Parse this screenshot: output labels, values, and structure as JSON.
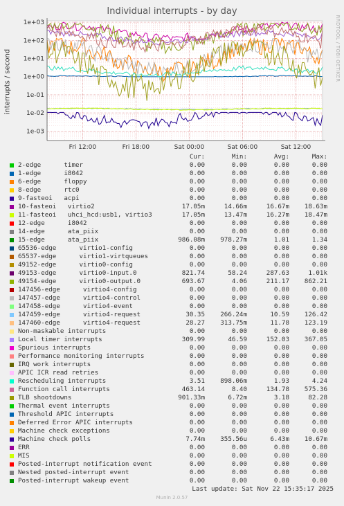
{
  "chart_data": {
    "type": "line",
    "title": "Individual interrupts - by day",
    "ylabel": "interrupts / second",
    "yscale": "log",
    "ylim": [
      0.0003,
      1200
    ],
    "y_ticks": [
      {
        "value": 1000,
        "label": "1e+03"
      },
      {
        "value": 100,
        "label": "1e+02"
      },
      {
        "value": 10,
        "label": "1e+01"
      },
      {
        "value": 1,
        "label": "1e+00"
      },
      {
        "value": 0.1,
        "label": "1e-01"
      },
      {
        "value": 0.01,
        "label": "1e-02"
      },
      {
        "value": 0.001,
        "label": "1e-03"
      }
    ],
    "x_ticks": [
      "Fri 12:00",
      "Fri 18:00",
      "Sat 00:00",
      "Sat 06:00",
      "Sat 12:00"
    ],
    "x_range_hours": [
      0,
      31
    ],
    "x_tick_positions_hours": [
      4,
      10,
      16,
      22,
      28
    ],
    "grid": true,
    "series": [
      {
        "name": "10-fasteoi virtio2",
        "color": "#7aa6c2",
        "cur": 0.01705,
        "min": 0.01466,
        "avg": 0.01667,
        "max": 0.01863
      },
      {
        "name": "11-fasteoi uhci_hcd:usb1, virtio3",
        "color": "#ccff00",
        "cur": 0.01705,
        "min": 0.01347,
        "avg": 0.01627,
        "max": 0.01847
      },
      {
        "name": "15-edge ata_piix",
        "color": "#0066b3",
        "cur": 0.98608,
        "min": 0.97827,
        "avg": 1.01,
        "max": 1.34
      },
      {
        "name": "49153-edge virtio0-input.0",
        "color": "#cc00a3",
        "cur": 821.74,
        "min": 58.24,
        "avg": 287.63,
        "max": 1010
      },
      {
        "name": "49154-edge virtio0-output.0",
        "color": "#8fa320",
        "cur": 693.67,
        "min": 4.06,
        "avg": 211.17,
        "max": 862.21
      },
      {
        "name": "147459-edge virtio4-request",
        "color": "#ff7f00",
        "cur": 30.35,
        "min": 0.266,
        "avg": 10.59,
        "max": 126.42
      },
      {
        "name": "147460-edge virtio4-request",
        "color": "#b8b8b8",
        "cur": 28.27,
        "min": 0.3138,
        "avg": 11.78,
        "max": 123.19
      },
      {
        "name": "Local timer interrupts",
        "color": "#a060d0",
        "cur": 309.99,
        "min": 46.59,
        "avg": 152.03,
        "max": 367.05
      },
      {
        "name": "Rescheduling interrupts",
        "color": "#33e0c0",
        "cur": 3.51,
        "min": 0.898,
        "avg": 1.93,
        "max": 4.24
      },
      {
        "name": "Function call interrupts",
        "color": "#c07070",
        "cur": 463.14,
        "min": 8.4,
        "avg": 134.78,
        "max": 575.36
      },
      {
        "name": "TLB shootdowns",
        "color": "#a0a020",
        "cur": 0.90133,
        "min": 0.00672,
        "avg": 3.18,
        "max": 82.28
      },
      {
        "name": "Machine check polls",
        "color": "#200090",
        "cur": 0.00774,
        "min": 0.000356,
        "avg": 0.00643,
        "max": 0.01067
      }
    ]
  },
  "watermark": "RRDTOOL / TOBI OETIKER",
  "legend": {
    "headers": [
      "Cur:",
      "Min:",
      "Avg:",
      "Max:"
    ],
    "rows": [
      {
        "label": "2-edge      timer",
        "color": "#00cc00",
        "cur": "0.00",
        "min": "0.00",
        "avg": "0.00",
        "max": "0.00"
      },
      {
        "label": "1-edge      i8042",
        "color": "#0066b3",
        "cur": "0.00",
        "min": "0.00",
        "avg": "0.00",
        "max": "0.00"
      },
      {
        "label": "6-edge      floppy",
        "color": "#ff8000",
        "cur": "0.00",
        "min": "0.00",
        "avg": "0.00",
        "max": "0.00"
      },
      {
        "label": "8-edge      rtc0",
        "color": "#ffcc00",
        "cur": "0.00",
        "min": "0.00",
        "avg": "0.00",
        "max": "0.00"
      },
      {
        "label": "9-fasteoi   acpi",
        "color": "#330099",
        "cur": "0.00",
        "min": "0.00",
        "avg": "0.00",
        "max": "0.00"
      },
      {
        "label": "10-fasteoi   virtio2",
        "color": "#990099",
        "cur": "17.05m",
        "min": "14.66m",
        "avg": "16.67m",
        "max": "18.63m"
      },
      {
        "label": "11-fasteoi   uhci_hcd:usb1, virtio3",
        "color": "#ccff00",
        "cur": "17.05m",
        "min": "13.47m",
        "avg": "16.27m",
        "max": "18.47m"
      },
      {
        "label": "12-edge      i8042",
        "color": "#ff0000",
        "cur": "0.00",
        "min": "0.00",
        "avg": "0.00",
        "max": "0.00"
      },
      {
        "label": "14-edge      ata_piix",
        "color": "#808080",
        "cur": "0.00",
        "min": "0.00",
        "avg": "0.00",
        "max": "0.00"
      },
      {
        "label": "15-edge      ata_piix",
        "color": "#008f00",
        "cur": "986.08m",
        "min": "978.27m",
        "avg": "1.01",
        "max": "1.34"
      },
      {
        "label": "65536-edge      virtio1-config",
        "color": "#00487d",
        "cur": "0.00",
        "min": "0.00",
        "avg": "0.00",
        "max": "0.00"
      },
      {
        "label": "65537-edge      virtio1-virtqueues",
        "color": "#b35a00",
        "cur": "0.00",
        "min": "0.00",
        "avg": "0.00",
        "max": "0.00"
      },
      {
        "label": "49152-edge      virtio0-config",
        "color": "#b38f00",
        "cur": "0.00",
        "min": "0.00",
        "avg": "0.00",
        "max": "0.00"
      },
      {
        "label": "49153-edge      virtio0-input.0",
        "color": "#6b006b",
        "cur": "821.74",
        "min": "58.24",
        "avg": "287.63",
        "max": "1.01k"
      },
      {
        "label": "49154-edge      virtio0-output.0",
        "color": "#8fb300",
        "cur": "693.67",
        "min": "4.06",
        "avg": "211.17",
        "max": "862.21"
      },
      {
        "label": "147456-edge      virtio4-config",
        "color": "#b30000",
        "cur": "0.00",
        "min": "0.00",
        "avg": "0.00",
        "max": "0.00"
      },
      {
        "label": "147457-edge      virtio4-control",
        "color": "#bebebe",
        "cur": "0.00",
        "min": "0.00",
        "avg": "0.00",
        "max": "0.00"
      },
      {
        "label": "147458-edge      virtio4-event",
        "color": "#80ff80",
        "cur": "0.00",
        "min": "0.00",
        "avg": "0.00",
        "max": "0.00"
      },
      {
        "label": "147459-edge      virtio4-request",
        "color": "#80c9ff",
        "cur": "30.35",
        "min": "266.24m",
        "avg": "10.59",
        "max": "126.42"
      },
      {
        "label": "147460-edge      virtio4-request",
        "color": "#ffc080",
        "cur": "28.27",
        "min": "313.75m",
        "avg": "11.78",
        "max": "123.19"
      },
      {
        "label": "Non-maskable interrupts",
        "color": "#ffe680",
        "cur": "0.00",
        "min": "0.00",
        "avg": "0.00",
        "max": "0.00"
      },
      {
        "label": "Local timer interrupts",
        "color": "#aa80ff",
        "cur": "309.99",
        "min": "46.59",
        "avg": "152.03",
        "max": "367.05"
      },
      {
        "label": "Spurious interrupts",
        "color": "#ee00cc",
        "cur": "0.00",
        "min": "0.00",
        "avg": "0.00",
        "max": "0.00"
      },
      {
        "label": "Performance monitoring interrupts",
        "color": "#ff8080",
        "cur": "0.00",
        "min": "0.00",
        "avg": "0.00",
        "max": "0.00"
      },
      {
        "label": "IRQ work interrupts",
        "color": "#666600",
        "cur": "0.00",
        "min": "0.00",
        "avg": "0.00",
        "max": "0.00"
      },
      {
        "label": "APIC ICR read retries",
        "color": "#ffbfff",
        "cur": "0.00",
        "min": "0.00",
        "avg": "0.00",
        "max": "0.00"
      },
      {
        "label": "Rescheduling interrupts",
        "color": "#00ffcc",
        "cur": "3.51",
        "min": "898.06m",
        "avg": "1.93",
        "max": "4.24"
      },
      {
        "label": "Function call interrupts",
        "color": "#cc6699",
        "cur": "463.14",
        "min": "8.40",
        "avg": "134.78",
        "max": "575.36"
      },
      {
        "label": "TLB shootdowns",
        "color": "#999900",
        "cur": "901.33m",
        "min": "6.72m",
        "avg": "3.18",
        "max": "82.28"
      },
      {
        "label": "Thermal event interrupts",
        "color": "#00cc00",
        "cur": "0.00",
        "min": "0.00",
        "avg": "0.00",
        "max": "0.00"
      },
      {
        "label": "Threshold APIC interrupts",
        "color": "#0066b3",
        "cur": "0.00",
        "min": "0.00",
        "avg": "0.00",
        "max": "0.00"
      },
      {
        "label": "Deferred Error APIC interrupts",
        "color": "#ff8000",
        "cur": "0.00",
        "min": "0.00",
        "avg": "0.00",
        "max": "0.00"
      },
      {
        "label": "Machine check exceptions",
        "color": "#ffcc00",
        "cur": "0.00",
        "min": "0.00",
        "avg": "0.00",
        "max": "0.00"
      },
      {
        "label": "Machine check polls",
        "color": "#330099",
        "cur": "7.74m",
        "min": "355.56u",
        "avg": "6.43m",
        "max": "10.67m"
      },
      {
        "label": "ERR",
        "color": "#990099",
        "cur": "0.00",
        "min": "0.00",
        "avg": "0.00",
        "max": "0.00"
      },
      {
        "label": "MIS",
        "color": "#ccff00",
        "cur": "0.00",
        "min": "0.00",
        "avg": "0.00",
        "max": "0.00"
      },
      {
        "label": "Posted-interrupt notification event",
        "color": "#ff0000",
        "cur": "0.00",
        "min": "0.00",
        "avg": "0.00",
        "max": "0.00"
      },
      {
        "label": "Nested posted-interrupt event",
        "color": "#808080",
        "cur": "0.00",
        "min": "0.00",
        "avg": "0.00",
        "max": "0.00"
      },
      {
        "label": "Posted-interrupt wakeup event",
        "color": "#008f00",
        "cur": "0.00",
        "min": "0.00",
        "avg": "0.00",
        "max": "0.00"
      }
    ]
  },
  "footer": {
    "last_update": "Last update: Sat Nov 22 15:35:17 2025",
    "version": "Munin 2.0.57"
  }
}
